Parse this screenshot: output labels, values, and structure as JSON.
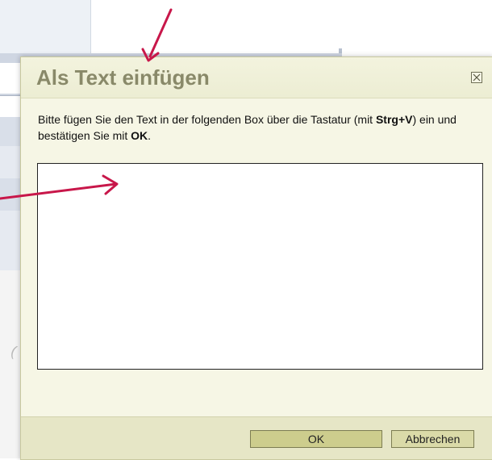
{
  "dialog": {
    "title": "Als Text einfügen",
    "instruction": {
      "part1": "Bitte fügen Sie den Text in der folgenden Box über die Tastatur (mit ",
      "shortcut": "Strg+V",
      "part2": ") ein und bestätigen Sie mit ",
      "ok_word": "OK",
      "part3": "."
    },
    "paste_area_value": "",
    "ok_label": "OK",
    "cancel_label": "Abbrechen"
  },
  "icons": {
    "close": "close-icon",
    "annotation": "arrow-annotation-icon"
  },
  "colors": {
    "dialog_bg": "#efefd3",
    "title": "#898969",
    "button_ok": "#cdcd8d",
    "annotation_arrow": "#c8174a"
  }
}
